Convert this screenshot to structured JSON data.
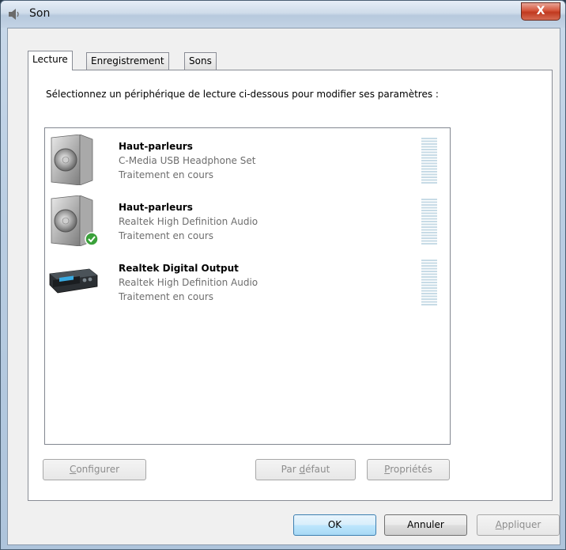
{
  "window": {
    "title": "Son",
    "close_glyph": "X"
  },
  "tabs": [
    {
      "label": "Lecture",
      "active": true
    },
    {
      "label": "Enregistrement",
      "active": false
    },
    {
      "label": "Sons",
      "active": false
    }
  ],
  "instruction": "Sélectionnez un périphérique de lecture ci-dessous pour modifier ses paramètres :",
  "devices": [
    {
      "name": "Haut-parleurs",
      "driver": "C-Media USB Headphone Set",
      "status": "Traitement en cours",
      "icon": "speaker-icon",
      "default": false
    },
    {
      "name": "Haut-parleurs",
      "driver": "Realtek High Definition Audio",
      "status": "Traitement en cours",
      "icon": "speaker-icon",
      "default": true
    },
    {
      "name": "Realtek Digital Output",
      "driver": "Realtek High Definition Audio",
      "status": "Traitement en cours",
      "icon": "digital-output-icon",
      "default": false
    }
  ],
  "panel_buttons": {
    "configure_prefix": "",
    "configure_accel": "C",
    "configure_rest": "onfigurer",
    "default_prefix": "Par ",
    "default_accel": "d",
    "default_rest": "éfaut",
    "properties_prefix": "",
    "properties_accel": "P",
    "properties_rest": "ropriétés"
  },
  "dialog_buttons": {
    "ok": "OK",
    "cancel": "Annuler",
    "apply_accel": "A",
    "apply_rest": "ppliquer"
  },
  "colors": {
    "accent": "#3c7fb1",
    "close": "#c0391f",
    "default_check": "#3aa13a"
  }
}
